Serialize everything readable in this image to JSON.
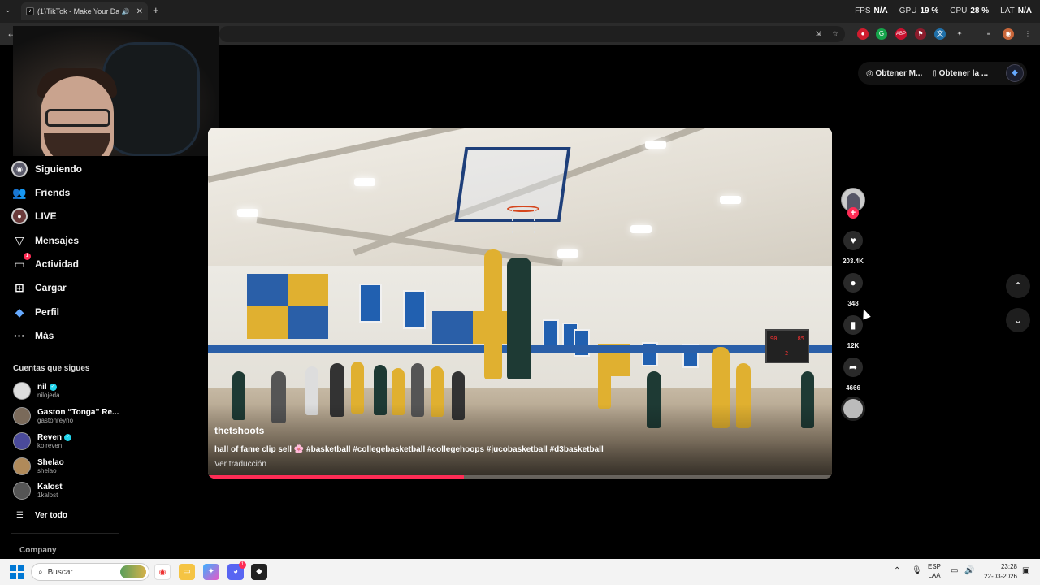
{
  "browser": {
    "tab_title": "(1)TikTok - Make Your Day",
    "tab_icon": "tiktok-icon",
    "stats": [
      {
        "label": "FPS",
        "value": "N/A"
      },
      {
        "label": "GPU",
        "value": "19 %"
      },
      {
        "label": "CPU",
        "value": "28 %"
      },
      {
        "label": "LAT",
        "value": "N/A"
      }
    ]
  },
  "top_pill": {
    "get_app_label": "Obtener M...",
    "get_desktop_label": "Obtener la ..."
  },
  "sidebar": {
    "nav": [
      {
        "label": "Siguiendo",
        "icon": "following-avatar-icon"
      },
      {
        "label": "Friends",
        "icon": "friends-icon"
      },
      {
        "label": "LIVE",
        "icon": "live-icon"
      },
      {
        "label": "Mensajes",
        "icon": "messages-icon"
      },
      {
        "label": "Actividad",
        "icon": "activity-icon",
        "badge": "1"
      },
      {
        "label": "Cargar",
        "icon": "upload-icon"
      },
      {
        "label": "Perfil",
        "icon": "profile-icon"
      },
      {
        "label": "Más",
        "icon": "more-icon"
      }
    ],
    "following_title": "Cuentas que sigues",
    "accounts": [
      {
        "name": "nil",
        "handle": "nilojeda",
        "verified": true
      },
      {
        "name": "Gaston “Tonga” Re...",
        "handle": "gastonreyno",
        "verified": false
      },
      {
        "name": "Reven",
        "handle": "koireven",
        "verified": true
      },
      {
        "name": "Shelao",
        "handle": "shelao",
        "verified": false
      },
      {
        "name": "Kalost",
        "handle": "1kalost",
        "verified": false
      }
    ],
    "see_all": "Ver todo",
    "company": "Company"
  },
  "video": {
    "author": "thetshoots",
    "description": "hall of fame clip sell 🌸 #basketball #collegebasketball #collegehoops #jucobasketball #d3basketball",
    "translate": "Ver traducción",
    "progress": 0.41,
    "scoreboard": {
      "left": "90",
      "right": "85",
      "period": "2"
    }
  },
  "actions": {
    "likes": "203.4K",
    "comments": "348",
    "saves": "12K",
    "shares": "4666"
  },
  "taskbar": {
    "search_placeholder": "Buscar",
    "lang_top": "ESP",
    "lang_bottom": "LAA",
    "time": "23:28",
    "date": "22-03-2026",
    "discord_badge": "1"
  },
  "colors": {
    "accent": "#fe2c55",
    "verified": "#20d5ec",
    "background": "#000000"
  }
}
